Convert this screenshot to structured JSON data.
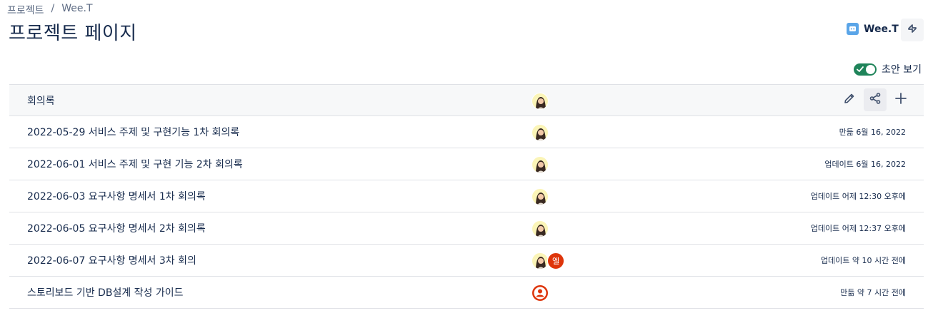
{
  "breadcrumb": {
    "items": [
      "프로젝트",
      "Wee.T"
    ],
    "separator": "/"
  },
  "page": {
    "title": "프로젝트 페이지"
  },
  "space": {
    "name": "Wee.T"
  },
  "draft_toggle": {
    "label": "초안 보기",
    "on": true
  },
  "table": {
    "header": {
      "title": "회의록"
    },
    "rows": [
      {
        "title": "2022-05-29 서비스 주제 및 구현기능 1차 회의록",
        "meta": "만듦 6월 16, 2022"
      },
      {
        "title": "2022-06-01 서비스 주제 및 구현 기능 2차 회의록",
        "meta": "업데이트 6월 16, 2022"
      },
      {
        "title": "2022-06-03 요구사항 명세서 1차 회의록",
        "meta": "업데이트 어제 12:30 오후에"
      },
      {
        "title": "2022-06-05 요구사항 명세서 2차 회의록",
        "meta": "업데이트 어제 12:37 오후에"
      },
      {
        "title": "2022-06-07 요구사항 명세서 3차 회의",
        "meta": "업데이트 약 10 시간 전에",
        "second_avatar": "엘"
      },
      {
        "title": "스토리보드 기반 DB설계 작성 가이드",
        "meta": "만듦 약 7 시간 전에"
      }
    ]
  },
  "colors": {
    "accent": "#1f845a",
    "avatar_red": "#de350b",
    "avatar_bg": "#fbf5b8",
    "text": "#172b4d",
    "muted": "#5e6c84"
  }
}
